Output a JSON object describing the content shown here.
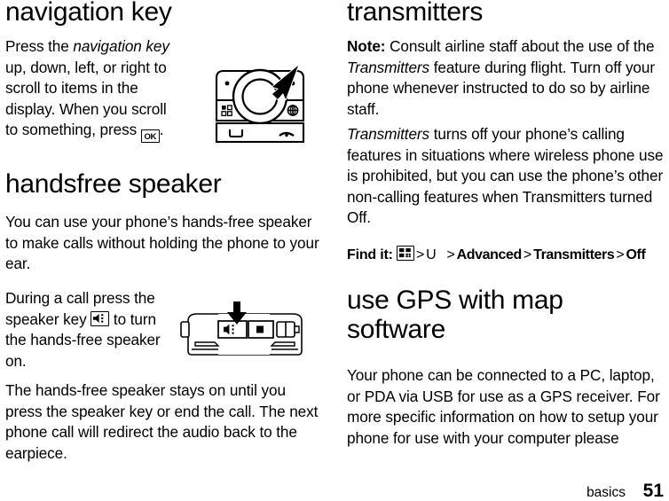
{
  "page": {
    "footer_crumb": "basics",
    "page_number": "51"
  },
  "left_column": {
    "navigation_key": {
      "title": "navigation key",
      "paragraph_prefix": "Press the ",
      "paragraph_italic": "navigation key",
      "paragraph_middle": " up, down, left, or right to scroll to items in the display. When you scroll to something, press ",
      "ok_key_label": "OK",
      "paragraph_suffix": ".",
      "figure_name": "phone-keypad-navigation-key-illustration"
    },
    "handsfree_speaker": {
      "title": "handsfree speaker",
      "paragraph_1": "You can use your phone’s hands-free speaker to make calls without holding the phone to your ear.",
      "paragraph_2_prefix": "During a call press the speaker key ",
      "paragraph_2_suffix": " to turn the hands-free speaker on.",
      "paragraph_3": "The hands-free speaker stays on until you press the speaker key or end the call. The next phone call will redirect the audio back to the earpiece.",
      "figure_name": "phone-side-speaker-key-illustration"
    }
  },
  "right_column": {
    "transmitters": {
      "title": "transmitters",
      "note_label": "Note:",
      "note_part1": " Consult airline staff about the use of the ",
      "note_italic": "Transmitters",
      "note_part2": " feature during flight. Turn off your phone whenever instructed to do so by airline staff.",
      "body_italic": "Transmitters",
      "body_text": " turns off your phone’s calling features in situations where wireless phone use is prohibited, but you can use the phone’s other non-calling features when Transmitters turned Off.",
      "find_it_label": "Find it:",
      "find_it_separator": ">",
      "find_it_step_settings_glyph": "U",
      "find_it_step_advanced": "Advanced",
      "find_it_step_transmitters": "Transmitters",
      "find_it_step_off": "Off"
    },
    "gps": {
      "title": "use GPS with map software",
      "paragraph": "Your phone can be connected to a PC, laptop, or PDA via USB for use as a GPS receiver. For more specific information on how to setup your phone for use with your computer please"
    }
  }
}
